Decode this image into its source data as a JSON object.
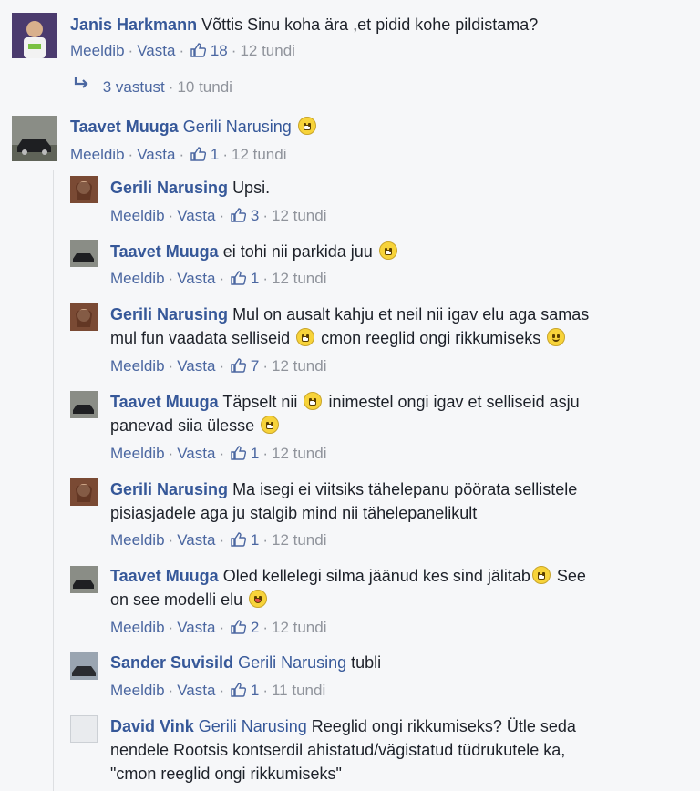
{
  "comments": [
    {
      "author": "Janis Harkmann",
      "mention": "",
      "text": "Võttis Sinu koha ära ,et pidid kohe pildistama?",
      "text2": "",
      "like": "Meeldib",
      "reply": "Vasta",
      "likes": "18",
      "time": "12 tundi"
    },
    {
      "author": "Taavet Muuga",
      "mention": "Gerili Narusing",
      "text": "",
      "text2": "",
      "like": "Meeldib",
      "reply": "Vasta",
      "likes": "1",
      "time": "12 tundi"
    },
    {
      "author": "Gerili Narusing",
      "mention": "",
      "text": "Upsi.",
      "text2": "",
      "like": "Meeldib",
      "reply": "Vasta",
      "likes": "3",
      "time": "12 tundi"
    },
    {
      "author": "Taavet Muuga",
      "mention": "",
      "text": "ei tohi nii parkida juu",
      "text2": "",
      "like": "Meeldib",
      "reply": "Vasta",
      "likes": "1",
      "time": "12 tundi"
    },
    {
      "author": "Gerili Narusing",
      "mention": "",
      "text": "Mul on ausalt kahju et neil nii igav elu aga samas",
      "text2": "mul fun vaadata selliseid",
      "text3": "cmon reeglid ongi rikkumiseks",
      "like": "Meeldib",
      "reply": "Vasta",
      "likes": "7",
      "time": "12 tundi"
    },
    {
      "author": "Taavet Muuga",
      "mention": "",
      "text": "Täpselt nii",
      "text1b": "inimestel ongi igav et selliseid asju",
      "text2": "panevad siia ülesse",
      "like": "Meeldib",
      "reply": "Vasta",
      "likes": "1",
      "time": "12 tundi"
    },
    {
      "author": "Gerili Narusing",
      "mention": "",
      "text": "Ma isegi ei viitsiks tähelepanu pöörata sellistele",
      "text2": "pisiasjadele aga ju stalgib mind nii tähelepanelikult",
      "like": "Meeldib",
      "reply": "Vasta",
      "likes": "1",
      "time": "12 tundi"
    },
    {
      "author": "Taavet Muuga",
      "mention": "",
      "text": "Oled kellelegi silma jäänud kes sind jälitab",
      "text1b": "See",
      "text2": "on see modelli elu",
      "like": "Meeldib",
      "reply": "Vasta",
      "likes": "2",
      "time": "12 tundi"
    },
    {
      "author": "Sander Suvisild",
      "mention": "Gerili Narusing",
      "text": "tubli",
      "text2": "",
      "like": "Meeldib",
      "reply": "Vasta",
      "likes": "1",
      "time": "11 tundi"
    },
    {
      "author": "David Vink",
      "mention": "Gerili Narusing",
      "text": "Reeglid ongi rikkumiseks? Ütle seda",
      "text2": "nendele Rootsis kontserdil ahistatud/vägistatud tüdrukutele ka,",
      "text3": "\"cmon reeglid ongi rikkumiseks\"",
      "like": "",
      "reply": "",
      "likes": "",
      "time": ""
    }
  ],
  "replies_link": {
    "count_label": "3 vastust",
    "time": "10 tundi"
  },
  "icons": {
    "like": "thumbs-up-icon",
    "reply": "reply-arrow-icon",
    "emoji": "emoji-icon"
  },
  "colors": {
    "link": "#365899",
    "action": "#4b67a1",
    "meta": "#90949c",
    "background": "#f6f7f9"
  }
}
